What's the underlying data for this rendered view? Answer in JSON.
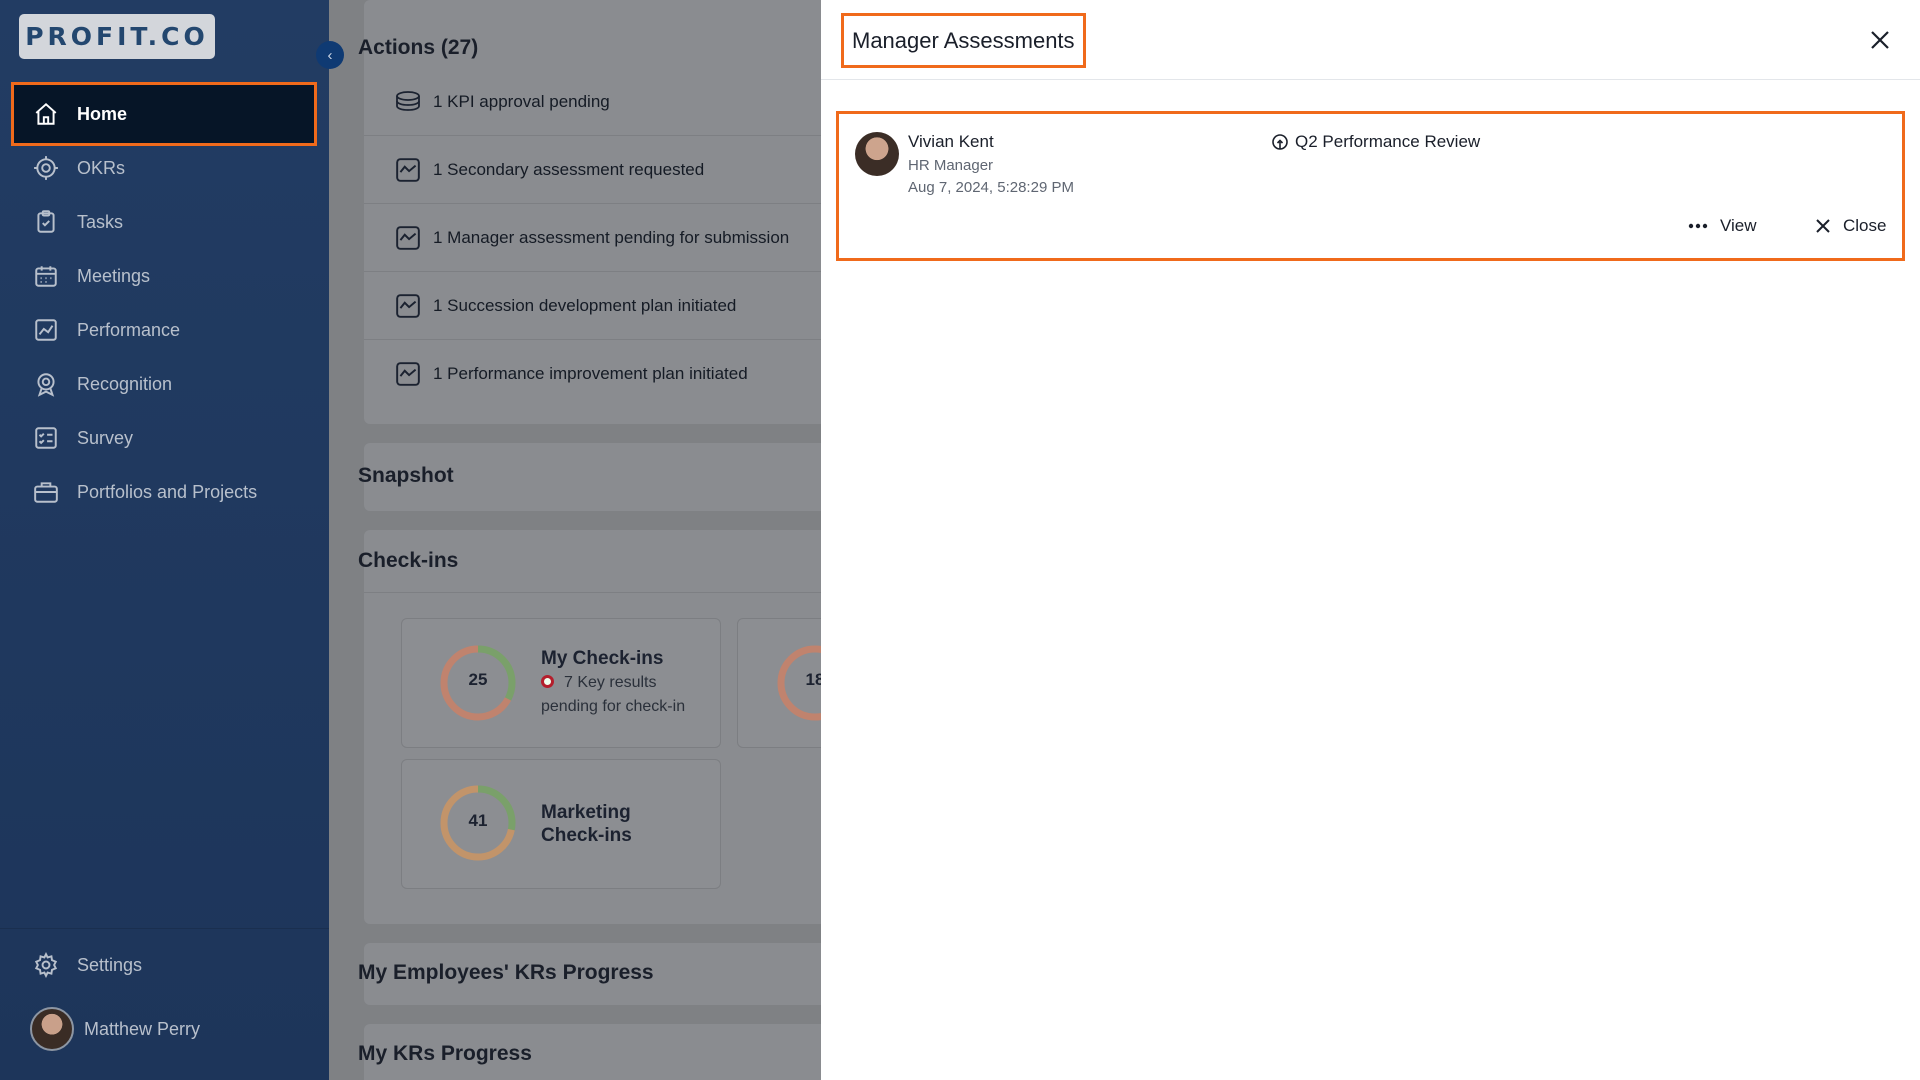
{
  "brand": {
    "logo_text": "PROFIT.CO"
  },
  "sidebar": {
    "items": [
      {
        "label": "Home",
        "icon": "home-icon",
        "active": true
      },
      {
        "label": "OKRs",
        "icon": "target-icon"
      },
      {
        "label": "Tasks",
        "icon": "clipboard-check-icon"
      },
      {
        "label": "Meetings",
        "icon": "calendar-icon"
      },
      {
        "label": "Performance",
        "icon": "trend-chart-icon"
      },
      {
        "label": "Recognition",
        "icon": "award-icon"
      },
      {
        "label": "Survey",
        "icon": "checklist-icon"
      },
      {
        "label": "Portfolios and Projects",
        "icon": "briefcase-icon"
      }
    ],
    "settings_label": "Settings",
    "user_name": "Matthew Perry"
  },
  "main": {
    "actions_title": "Actions (27)",
    "actions": [
      "1 KPI approval pending",
      "1 Secondary assessment requested",
      "1 Manager assessment pending for submission",
      "1 Succession development plan initiated",
      "1 Performance improvement plan initiated"
    ],
    "snapshot_title": "Snapshot",
    "checkins_title": "Check-ins",
    "checkins": {
      "my_value": "25",
      "my_title": "My Check-ins",
      "my_sub_line1": "7 Key results",
      "my_sub_line2": "pending for check-in",
      "second_value": "18",
      "marketing_value": "41",
      "marketing_title_line1": "Marketing",
      "marketing_title_line2": "Check-ins"
    },
    "employees_krs_title": "My Employees' KRs Progress",
    "my_krs_title": "My KRs Progress"
  },
  "drawer": {
    "title": "Manager Assessments",
    "assessment": {
      "name": "Vivian Kent",
      "role": "HR Manager",
      "date": "Aug 7, 2024, 5:28:29 PM",
      "review_name": "Q2 Performance Review",
      "view_label": "View",
      "close_label": "Close"
    }
  },
  "colors": {
    "highlight": "#f06a1b",
    "sidebar_bg": "#223c63",
    "overlay": "#7f8184"
  }
}
